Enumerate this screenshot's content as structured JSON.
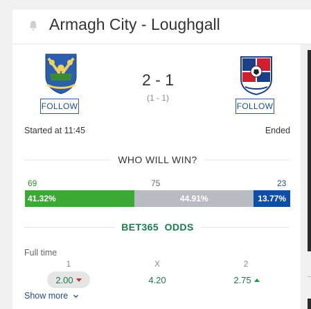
{
  "header": {
    "title": "Armagh City - Loughgall"
  },
  "match": {
    "home_team": "Armagh City",
    "away_team": "Loughgall",
    "score": "2 - 1",
    "halftime_score": "(1 - 1)",
    "started": "Started at 11:45",
    "status": "Ended",
    "follow_label": "FOLLOW"
  },
  "prediction": {
    "title": "WHO WILL WIN?",
    "votes": {
      "home": "69",
      "draw": "75",
      "away": "23"
    },
    "percent_labels": {
      "home": "41.32%",
      "draw": "44.91%",
      "away": "13.77%"
    },
    "percent_values": {
      "home": 41.32,
      "draw": 44.91,
      "away": 13.77
    },
    "colors": {
      "home": "#3aaa35",
      "draw": "#b8bcc2",
      "away": "#0b4fa8",
      "home_text": "#3a8a2a"
    }
  },
  "odds": {
    "title": "BET365  ODDS",
    "period": "Full time",
    "headers": {
      "home": "1",
      "draw": "X",
      "away": "2"
    },
    "values": {
      "home": "2.00",
      "draw": "4.20",
      "away": "2.75"
    },
    "trend": {
      "home": "down",
      "away": "up"
    },
    "show_more": "Show more"
  },
  "icons": {
    "bell": "bell-icon",
    "chevron": "chevron-down-icon"
  }
}
